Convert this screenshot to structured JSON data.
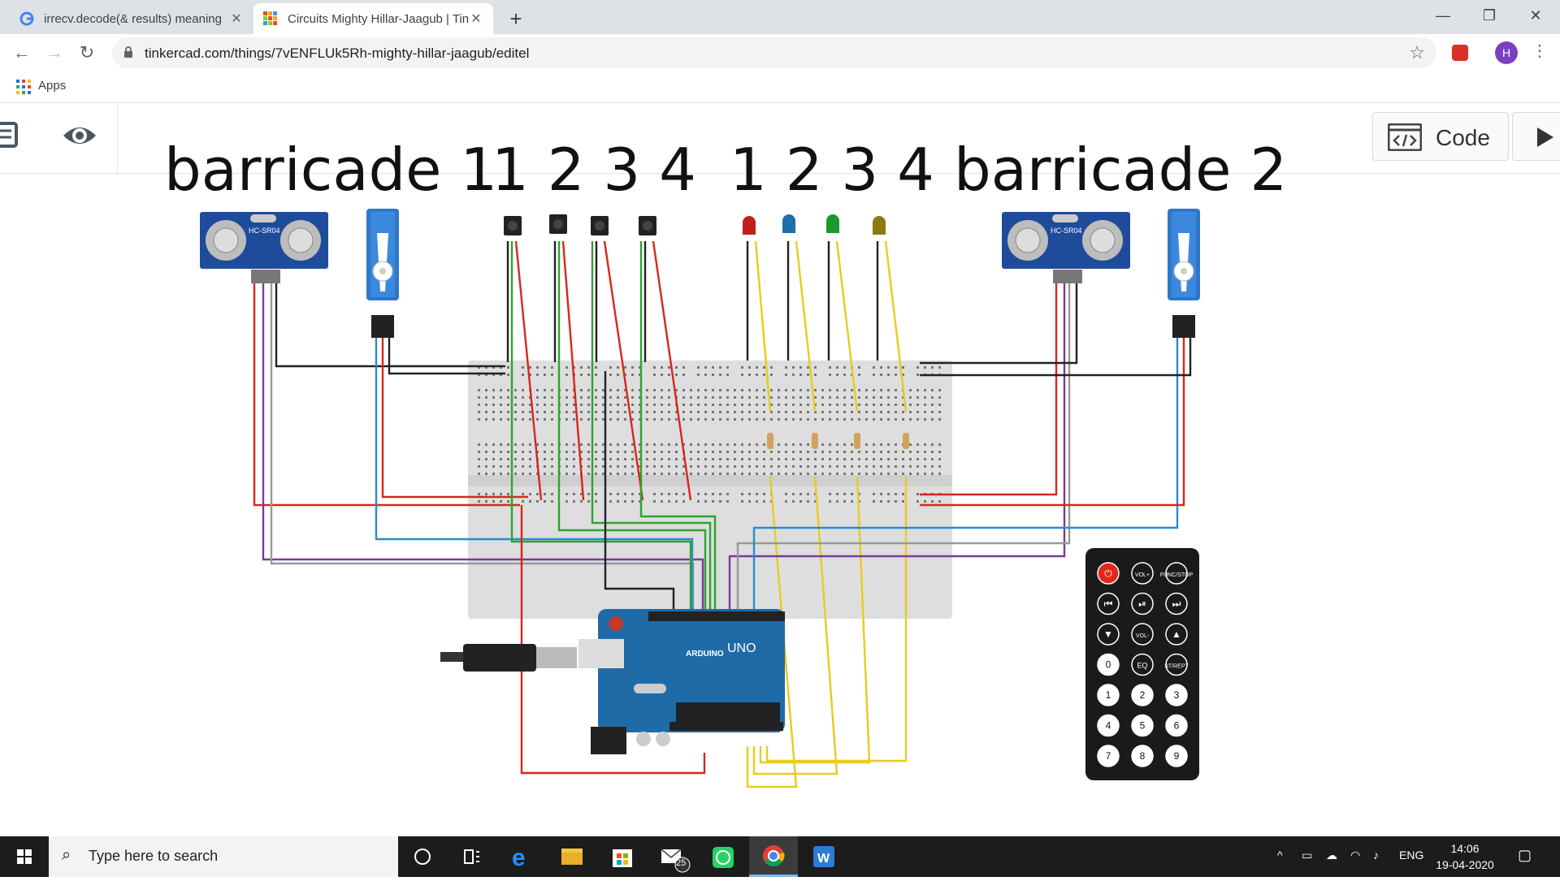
{
  "browser": {
    "tabs": [
      {
        "title": "irrecv.decode(& results) meaning",
        "active": false,
        "favicon": "google-icon"
      },
      {
        "title": "Circuits Mighty Hillar-Jaagub | Tin",
        "active": true,
        "favicon": "tinkercad-icon"
      }
    ],
    "url": "tinkercad.com/things/7vENFLUk5Rh-mighty-hillar-jaagub/editel",
    "profile_initial": "H",
    "bookmarks": {
      "apps_label": "Apps"
    }
  },
  "workspace": {
    "labels": {
      "barricade1": "barricade 1",
      "barricade2": "barricade 2",
      "buttons_numbers": "1 2 3 4",
      "leds_numbers": "1 2 3 4"
    },
    "code_button_label": "Code",
    "components": {
      "ultrasonic_label": "HC-SR04",
      "arduino_brand": "ARDUINO",
      "arduino_model": "UNO",
      "led_colors": [
        "#c0201c",
        "#1e6fa8",
        "#1a9a2e",
        "#8c7a14"
      ]
    },
    "remote": {
      "rows": [
        [
          "⏻",
          "VOL+",
          "FUNC/STOP"
        ],
        [
          "⏮",
          "⏯",
          "⏭"
        ],
        [
          "▼",
          "VOL-",
          "▲"
        ],
        [
          "0",
          "EQ",
          "ST/REPT"
        ],
        [
          "1",
          "2",
          "3"
        ],
        [
          "4",
          "5",
          "6"
        ],
        [
          "7",
          "8",
          "9"
        ]
      ]
    }
  },
  "taskbar": {
    "search_placeholder": "Type here to search",
    "mail_badge": "25",
    "language": "ENG",
    "time": "14:06",
    "date": "19-04-2020"
  }
}
